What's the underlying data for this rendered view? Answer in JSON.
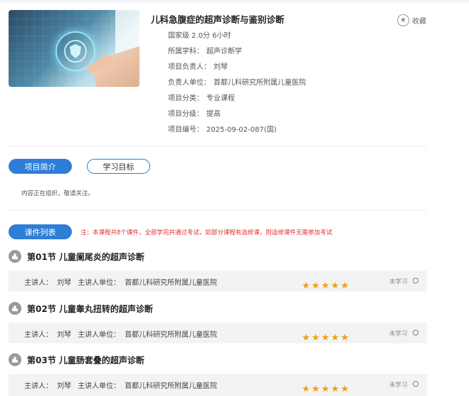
{
  "course": {
    "title": "儿科急腹症的超声诊断与鉴别诊断",
    "credit": "国家级 2.0分 6小时",
    "fields": [
      {
        "label": "所属学科：",
        "value": "超声诊断学"
      },
      {
        "label": "项目负责人：",
        "value": "刘琴"
      },
      {
        "label": "负责人单位：",
        "value": "首都儿科研究所附属儿童医院"
      },
      {
        "label": "项目分类：",
        "value": "专业课程"
      },
      {
        "label": "项目分级：",
        "value": "提高"
      },
      {
        "label": "项目编号：",
        "value": "2025-09-02-087(国)"
      }
    ],
    "favorite_label": "收藏"
  },
  "tabs": {
    "intro": "项目简介",
    "goals": "学习目标",
    "intro_content": "内容正在组织，敬请关注。"
  },
  "course_list": {
    "tab_label": "课件列表",
    "note": "注：本课程共8个课件，全部学完并通过考试，如部分课程有选修课，则选修课件无需参加考试",
    "lessons": [
      {
        "title": "第01节 儿童阑尾炎的超声诊断",
        "lecturer_label": "主讲人：",
        "lecturer": "刘琴",
        "unit_label": "主讲人单位：",
        "unit": "首都儿科研究所附属儿童医院",
        "rating": 5,
        "status": "未学习"
      },
      {
        "title": "第02节 儿童睾丸扭转的超声诊断",
        "lecturer_label": "主讲人：",
        "lecturer": "刘琴",
        "unit_label": "主讲人单位：",
        "unit": "首都儿科研究所附属儿童医院",
        "rating": 5,
        "status": "未学习"
      },
      {
        "title": "第03节 儿童肠套叠的超声诊断",
        "lecturer_label": "主讲人：",
        "lecturer": "刘琴",
        "unit_label": "主讲人单位：",
        "unit": "首都儿科研究所附属儿童医院",
        "rating": 5,
        "status": "未学习"
      }
    ]
  },
  "colors": {
    "accent": "#2e7dd6",
    "note": "#e23232",
    "star": "#f0a010"
  }
}
